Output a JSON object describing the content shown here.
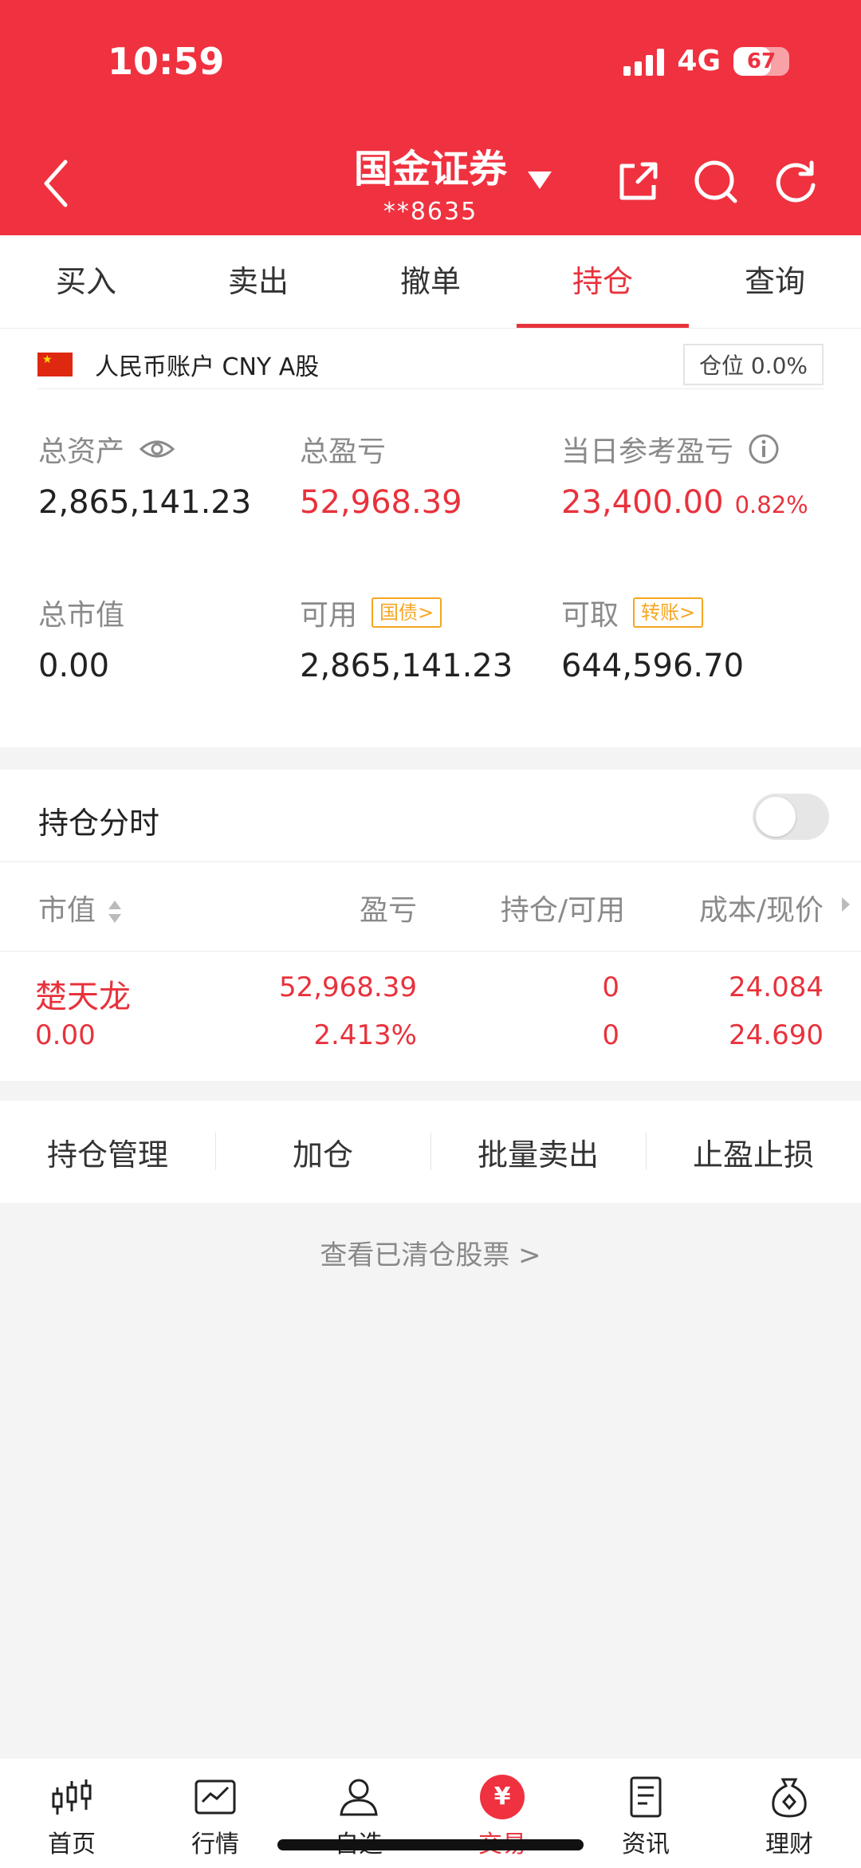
{
  "status_bar": {
    "time": "10:59",
    "network": "4G",
    "battery": "67",
    "battery_level_percent": 67
  },
  "header": {
    "title": "国金证券",
    "account": "**8635"
  },
  "tabs": [
    {
      "label": "买入"
    },
    {
      "label": "卖出"
    },
    {
      "label": "撤单"
    },
    {
      "label": "持仓",
      "active": true
    },
    {
      "label": "查询"
    }
  ],
  "account_info": {
    "label": "人民币账户 CNY A股",
    "position_ratio": "仓位 0.0%"
  },
  "summary": {
    "total_assets_label": "总资产",
    "total_assets": "2,865,141.23",
    "total_pl_label": "总盈亏",
    "total_pl": "52,968.39",
    "daily_pl_label": "当日参考盈亏",
    "daily_pl": "23,400.00",
    "daily_pl_pct": "0.82%",
    "market_value_label": "总市值",
    "market_value": "0.00",
    "available_label": "可用",
    "available_tag": "国债>",
    "available": "2,865,141.23",
    "withdrawable_label": "可取",
    "withdrawable_tag": "转账>",
    "withdrawable": "644,596.70"
  },
  "holdings": {
    "section_title": "持仓分时",
    "toggle_on": false,
    "columns": [
      "市值",
      "盈亏",
      "持仓/可用",
      "成本/现价"
    ],
    "rows": [
      {
        "name": "楚天龙",
        "market_value": "0.00",
        "pl": "52,968.39",
        "pl_pct": "2.413%",
        "position": "0",
        "available": "0",
        "cost": "24.084",
        "price": "24.690"
      }
    ]
  },
  "actions": [
    "持仓管理",
    "加仓",
    "批量卖出",
    "止盈止损"
  ],
  "view_cleared": "查看已清仓股票 >",
  "tabbar": [
    {
      "label": "首页",
      "icon": "candlestick-icon"
    },
    {
      "label": "行情",
      "icon": "chart-icon"
    },
    {
      "label": "自选",
      "icon": "person-icon"
    },
    {
      "label": "交易",
      "icon": "yen-icon",
      "active": true
    },
    {
      "label": "资讯",
      "icon": "document-icon"
    },
    {
      "label": "理财",
      "icon": "money-bag-icon"
    }
  ],
  "colors": {
    "brand_red": "#f0313f",
    "accent_red": "#e8323c",
    "tag_orange": "#f5a623"
  }
}
